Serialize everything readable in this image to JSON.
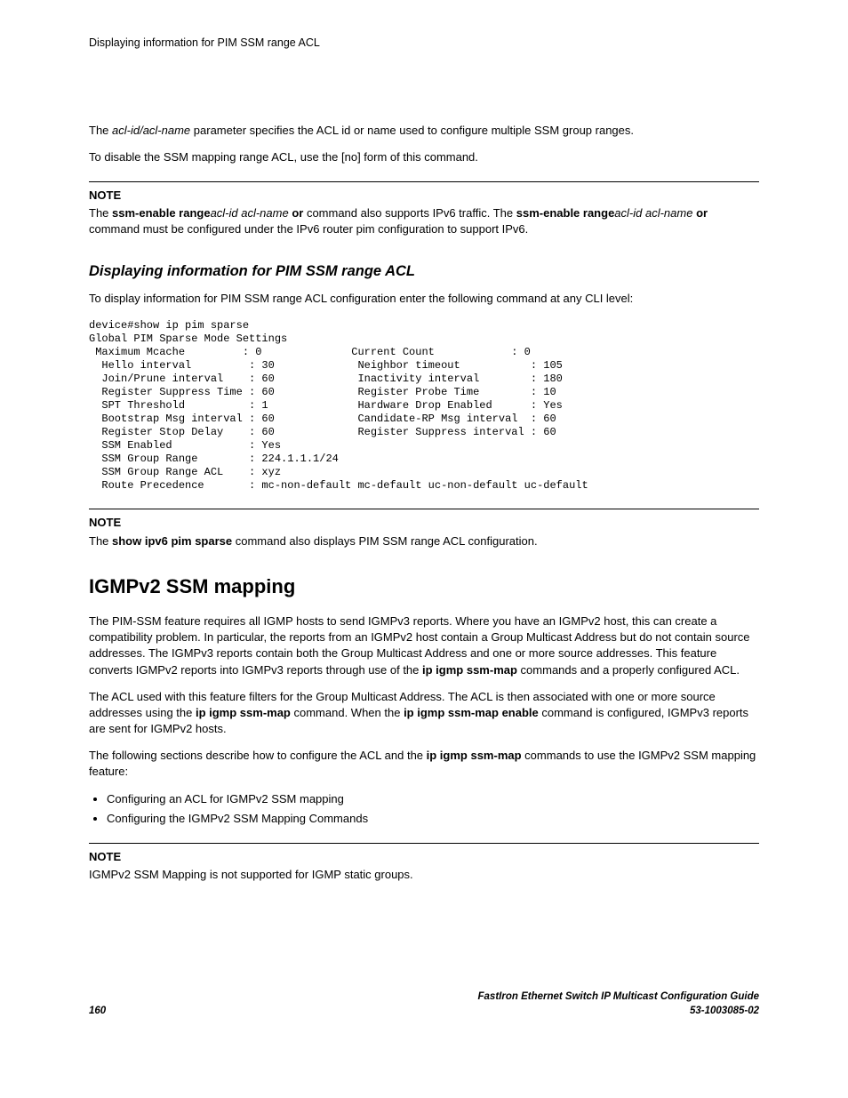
{
  "runningHead": "Displaying information for PIM SSM range ACL",
  "para1": {
    "a": "The ",
    "b": "acl-id/acl-name",
    "c": " parameter specifies the ACL id or name used to configure multiple SSM group ranges."
  },
  "para2": "To disable the SSM mapping range ACL, use the [no] form of this command.",
  "note1": {
    "label": "NOTE",
    "a": "The ",
    "b": "ssm-enable range",
    "c": "acl-id acl-name ",
    "d": "or",
    "e": " command also supports IPv6 traffic. The ",
    "f": "ssm-enable range",
    "g": "acl-id acl-name ",
    "h": "or",
    "i": " command must be configured under the IPv6 router pim configuration to support IPv6."
  },
  "subhead1": "Displaying information for PIM SSM range ACL",
  "para3": "To display information for PIM SSM range ACL configuration enter the following command at any CLI level:",
  "cli": "device#show ip pim sparse\nGlobal PIM Sparse Mode Settings\n Maximum Mcache         : 0              Current Count            : 0\n  Hello interval         : 30             Neighbor timeout           : 105\n  Join/Prune interval    : 60             Inactivity interval        : 180\n  Register Suppress Time : 60             Register Probe Time        : 10\n  SPT Threshold          : 1              Hardware Drop Enabled      : Yes\n  Bootstrap Msg interval : 60             Candidate-RP Msg interval  : 60\n  Register Stop Delay    : 60             Register Suppress interval : 60\n  SSM Enabled            : Yes\n  SSM Group Range        : 224.1.1.1/24\n  SSM Group Range ACL    : xyz\n  Route Precedence       : mc-non-default mc-default uc-non-default uc-default",
  "note2": {
    "label": "NOTE",
    "a": "The ",
    "b": "show ipv6 pim sparse",
    "c": " command also displays PIM SSM range ACL configuration."
  },
  "section1": "IGMPv2 SSM mapping",
  "para4": {
    "a": "The PIM-SSM feature requires all IGMP hosts to send IGMPv3 reports. Where you have an IGMPv2 host, this can create a compatibility problem. In particular, the reports from an IGMPv2 host contain a Group Multicast Address but do not contain source addresses. The IGMPv3 reports contain both the Group Multicast Address and one or more source addresses. This feature converts IGMPv2 reports into IGMPv3 reports through use of the ",
    "b": "ip igmp ssm-map",
    "c": " commands and a properly configured ACL."
  },
  "para5": {
    "a": "The ACL used with this feature filters for the Group Multicast Address. The ACL is then associated with one or more source addresses using the ",
    "b": "ip igmp ssm-map",
    "c": " command. When the ",
    "d": "ip igmp ssm-map enable",
    "e": " command is configured, IGMPv3 reports are sent for IGMPv2 hosts."
  },
  "para6": {
    "a": "The following sections describe how to configure the ACL and the ",
    "b": "ip igmp ssm-map",
    "c": " commands to use the IGMPv2 SSM mapping feature:"
  },
  "bullets": {
    "b1": "Configuring an ACL for IGMPv2 SSM mapping",
    "b2": "Configuring the IGMPv2 SSM Mapping Commands"
  },
  "note3": {
    "label": "NOTE",
    "body": "IGMPv2 SSM Mapping is not supported for IGMP static groups."
  },
  "footer": {
    "page": "160",
    "title": "FastIron Ethernet Switch IP Multicast Configuration Guide",
    "docnum": "53-1003085-02"
  }
}
